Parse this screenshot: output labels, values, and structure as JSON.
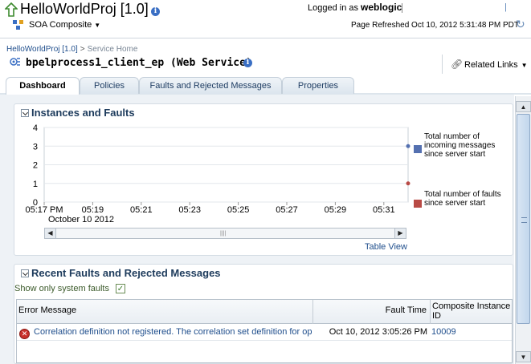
{
  "header": {
    "title": "HelloWorldProj [1.0]",
    "composite_menu": "SOA Composite",
    "logged_in_label": "Logged in as",
    "username": "weblogic",
    "page_refreshed": "Page Refreshed Oct 10, 2012 5:31:48 PM PDT"
  },
  "breadcrumb": {
    "parent": "HelloWorldProj [1.0]",
    "separator": ">",
    "current": "Service Home"
  },
  "page": {
    "title": "bpelprocess1_client_ep (Web Service)",
    "related_links": "Related Links"
  },
  "tabs": [
    {
      "label": "Dashboard",
      "active": true
    },
    {
      "label": "Policies",
      "active": false
    },
    {
      "label": "Faults and Rejected Messages",
      "active": false
    },
    {
      "label": "Properties",
      "active": false
    }
  ],
  "instances_panel": {
    "title": "Instances and Faults",
    "table_view": "Table View"
  },
  "chart_data": {
    "type": "line",
    "y_ticks": [
      "4",
      "3",
      "2",
      "1",
      "0"
    ],
    "ylim": [
      0,
      4
    ],
    "x_ticks": [
      "05:17 PM",
      "05:19",
      "05:21",
      "05:23",
      "05:25",
      "05:27",
      "05:29",
      "05:31"
    ],
    "x_sublabel": "October 10 2012",
    "grid": true,
    "legend_position": "right",
    "series": [
      {
        "name": "Total number of incoming messages since server start",
        "color": "#5470b0",
        "points": [
          {
            "x": "05:32",
            "y": 3
          }
        ]
      },
      {
        "name": "Total number of faults since server start",
        "color": "#b84a45",
        "points": [
          {
            "x": "05:32",
            "y": 1
          }
        ]
      }
    ]
  },
  "faults_panel": {
    "title": "Recent Faults and Rejected Messages",
    "filter_label": "Show only system faults",
    "filter_checked": "✓",
    "columns": [
      "Error Message",
      "Fault Time",
      "Composite Instance ID"
    ],
    "rows": [
      {
        "error": "Correlation definition not registered. The correlation set definition for operation",
        "time": "Oct 10, 2012 3:05:26 PM",
        "instance_id": "10009"
      }
    ]
  },
  "colors": {
    "tab_text": "#1f3d63",
    "link": "#1f4e8c",
    "panel_title": "#1d3b5c",
    "error": "#c8302a"
  }
}
